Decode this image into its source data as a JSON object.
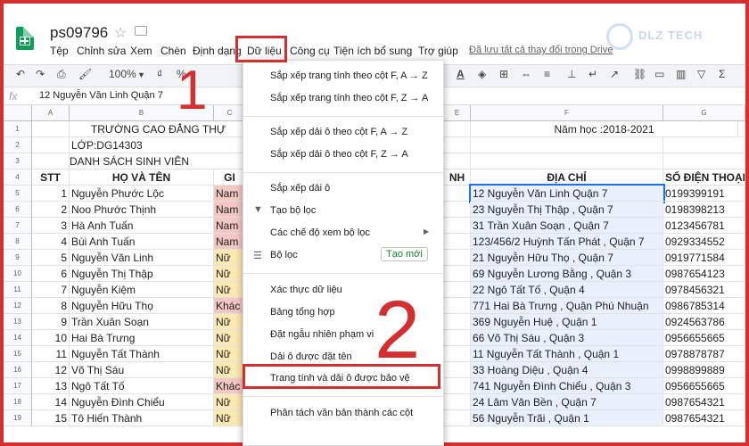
{
  "app": {
    "title": "ps09796",
    "save_status": "Đã lưu tất cả thay đổi trong Drive",
    "watermark": "DLZ TECH"
  },
  "menubar": [
    "Tệp",
    "Chỉnh sửa",
    "Xem",
    "Chèn",
    "Định dạng",
    "Dữ liệu",
    "Công cụ",
    "Tiện ích bổ sung",
    "Trợ giúp"
  ],
  "toolbar": {
    "zoom": "100%",
    "currency": "₫",
    "percent": "%"
  },
  "formula_bar": {
    "fx": "fx",
    "value": "12 Nguyễn Văn Linh Quận 7"
  },
  "columns": [
    "A",
    "B",
    "C",
    "D",
    "E",
    "F",
    "G"
  ],
  "rows": [
    {
      "n": "1",
      "a": "",
      "b": "TRƯỜNG CAO ĐẲNG THỰ",
      "c": "",
      "e": "",
      "f": "Năm học :2018-2021",
      "g": ""
    },
    {
      "n": "2",
      "a": "",
      "b": "LỚP:DG14303",
      "c": "",
      "e": "",
      "f": "",
      "g": ""
    },
    {
      "n": "3",
      "a": "",
      "b": "DANH SÁCH SINH VIÊN",
      "c": "",
      "e": "",
      "f": "",
      "g": ""
    },
    {
      "n": "4",
      "a": "STT",
      "b": "HỌ VÀ TÊN",
      "c": "GI",
      "e": "NH",
      "f": "ĐỊA CHỈ",
      "g": "SỐ ĐIỆN THOẠI"
    },
    {
      "n": "5",
      "a": "1",
      "b": "Nguyễn Phước Lộc",
      "c": "Nam",
      "e": "",
      "f": "12 Nguyễn Văn Linh Quận 7",
      "g": "0199399191"
    },
    {
      "n": "6",
      "a": "2",
      "b": "Noo Phước Thịnh",
      "c": "Nam",
      "e": "",
      "f": "23 Nguyễn Thị Thập , Quận 7",
      "g": "0198398213"
    },
    {
      "n": "7",
      "a": "3",
      "b": "Hà Anh Tuấn",
      "c": "Nam",
      "e": "",
      "f": "31 Trần Xuân Soạn , Quận 7",
      "g": "0123456781"
    },
    {
      "n": "8",
      "a": "4",
      "b": "Bùi Anh Tuấn",
      "c": "Nam",
      "e": "",
      "f": "123/456/2 Huỳnh Tấn Phát , Quận 7",
      "g": "0929334552"
    },
    {
      "n": "9",
      "a": "5",
      "b": "Nguyễn Văn Linh",
      "c": "Nữ",
      "e": "",
      "f": "21 Nguyễn Hữu Thọ , Quận 7",
      "g": "0919771584"
    },
    {
      "n": "10",
      "a": "6",
      "b": "Nguyễn Thị Thập",
      "c": "Nữ",
      "e": "",
      "f": "69 Nguyễn Lương Bằng , Quận 3",
      "g": "0987654123"
    },
    {
      "n": "11",
      "a": "7",
      "b": "Nguyễn Kiệm",
      "c": "Nữ",
      "e": "",
      "f": "22 Ngô Tất Tố , Quận 4",
      "g": "0978456321"
    },
    {
      "n": "12",
      "a": "8",
      "b": "Nguyễn Hữu Thọ",
      "c": "Khác",
      "e": "",
      "f": "771 Hai Bà Trưng , Quận Phú Nhuận",
      "g": "0986785314"
    },
    {
      "n": "13",
      "a": "9",
      "b": "Trần Xuân Soạn",
      "c": "Nữ",
      "e": "",
      "f": "369 Nguyễn Huệ , Quận 1",
      "g": "0924563786"
    },
    {
      "n": "14",
      "a": "10",
      "b": "Hai Bà Trưng",
      "c": "Nữ",
      "e": "",
      "f": "66 Võ Thị Sáu , Quận 3",
      "g": "0956655665"
    },
    {
      "n": "15",
      "a": "11",
      "b": "Nguyễn Tất Thành",
      "c": "Nữ",
      "e": "",
      "f": "11  Nguyễn Tất Thành , Quận 1",
      "g": "0978878787"
    },
    {
      "n": "16",
      "a": "12",
      "b": "Võ Thị Sáu",
      "c": "Nữ",
      "e": "",
      "f": "33 Hoàng Diệu , Quận 4",
      "g": "0998899889"
    },
    {
      "n": "17",
      "a": "13",
      "b": "Ngô Tất Tố",
      "c": "Khác",
      "e": "",
      "f": "741 Nguyễn Đình Chiểu , Quận 3",
      "g": "0956655665"
    },
    {
      "n": "18",
      "a": "14",
      "b": "Nguyễn Đình Chiểu",
      "c": "Nữ",
      "e": "",
      "f": "24 Lâm Văn Bền , Quận 7",
      "g": "0987654321"
    },
    {
      "n": "19",
      "a": "15",
      "b": "Tô Hiến Thành",
      "c": "Nữ",
      "e": "",
      "f": "56 Nguyễn Trãi , Quận 1",
      "g": "0987654321"
    }
  ],
  "data_menu": {
    "items": [
      "Sắp xếp trang tính theo cột F, A → Z",
      "Sắp xếp trang tính theo cột F, Z → A",
      "Sắp xếp dải ô theo cột F, A → Z",
      "Sắp xếp dải ô theo cột F, Z → A",
      "Sắp xếp dải ô",
      "Tạo bộ lọc",
      "Các chế độ xem bộ lọc",
      "Bộ lọc",
      "Xác thực dữ liệu",
      "Bảng tổng hợp",
      "Đặt ngẫu nhiên phạm vi",
      "Dải ô được đặt tên",
      "Trang tính và dải ô được bảo vệ",
      "Phân tách văn bản thành các cột"
    ],
    "new_badge": "Tạo mới"
  },
  "callouts": {
    "step1": "1",
    "step2": "2",
    "color": "#d32f2f"
  }
}
